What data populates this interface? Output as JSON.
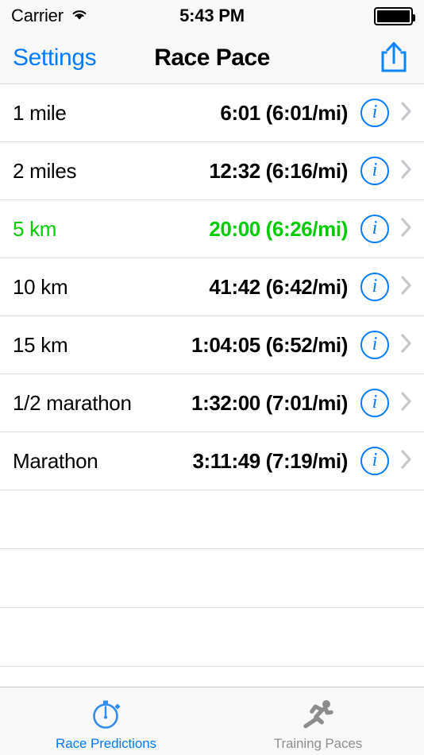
{
  "status_bar": {
    "carrier": "Carrier",
    "wifi_icon": "wifi-icon",
    "time": "5:43 PM",
    "battery_icon": "battery-full-icon"
  },
  "nav_bar": {
    "left_button": "Settings",
    "title": "Race Pace",
    "right_icon": "share-icon"
  },
  "colors": {
    "accent_blue": "#007aff",
    "highlight_green": "#00cc00",
    "inactive_gray": "#8e8e93",
    "chrome_background": "#f8f8f8",
    "separator": "#dcdcdc"
  },
  "table": {
    "rows": [
      {
        "label": "1 mile",
        "value": "6:01 (6:01/mi)",
        "highlighted": false,
        "info_icon": "info-icon",
        "chevron_icon": "chevron-right-icon"
      },
      {
        "label": "2 miles",
        "value": "12:32 (6:16/mi)",
        "highlighted": false,
        "info_icon": "info-icon",
        "chevron_icon": "chevron-right-icon"
      },
      {
        "label": "5 km",
        "value": "20:00 (6:26/mi)",
        "highlighted": true,
        "info_icon": "info-icon",
        "chevron_icon": "chevron-right-icon"
      },
      {
        "label": "10 km",
        "value": "41:42 (6:42/mi)",
        "highlighted": false,
        "info_icon": "info-icon",
        "chevron_icon": "chevron-right-icon"
      },
      {
        "label": "15 km",
        "value": "1:04:05 (6:52/mi)",
        "highlighted": false,
        "info_icon": "info-icon",
        "chevron_icon": "chevron-right-icon"
      },
      {
        "label": "1/2 marathon",
        "value": "1:32:00 (7:01/mi)",
        "highlighted": false,
        "info_icon": "info-icon",
        "chevron_icon": "chevron-right-icon"
      },
      {
        "label": "Marathon",
        "value": "3:11:49 (7:19/mi)",
        "highlighted": false,
        "info_icon": "info-icon",
        "chevron_icon": "chevron-right-icon"
      }
    ],
    "empty_row_count": 3
  },
  "tab_bar": {
    "tabs": [
      {
        "label": "Race Predictions",
        "icon": "stopwatch-icon",
        "active": true
      },
      {
        "label": "Training Paces",
        "icon": "runner-icon",
        "active": false
      }
    ]
  }
}
